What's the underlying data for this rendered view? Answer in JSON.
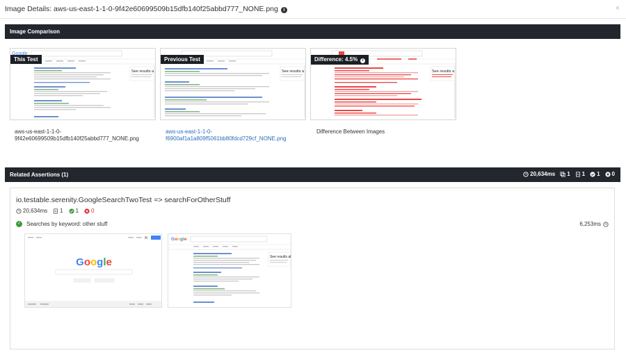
{
  "modal": {
    "title": "Image Details: aws-us-east-1-1-0-9f42e60699509b15dfb140f25abbd777_NONE.png",
    "close_label": "×"
  },
  "comparison": {
    "title": "Image Comparison",
    "this_test": {
      "label": "This Test",
      "caption": "aws-us-east-1-1-0-9f42e60699509b15dfb140f25abbd777_NONE.png"
    },
    "previous_test": {
      "label": "Previous Test",
      "caption": "aws-us-east-1-1-0-f6900af1a1a809f5061bb80fdcd729cf_NONE.png"
    },
    "difference": {
      "label": "Difference: 4.5%",
      "caption": "Difference Between Images"
    }
  },
  "assertions": {
    "title": "Related Assertions (1)",
    "stats": {
      "time": "20,634ms",
      "copies": "1",
      "docs": "1",
      "passed": "1",
      "failed": "0"
    }
  },
  "test": {
    "name": "io.testable.serenity.GoogleSearchTwoTest => searchForOtherStuff",
    "time": "20,634ms",
    "docs": "1",
    "passed": "1",
    "failed": "0",
    "assertion": {
      "label": "Searches by keyword: other stuff",
      "time": "6,253ms"
    }
  },
  "colors": {
    "header_bg": "#22262d",
    "pass": "#3c9a3c",
    "fail": "#d9302c",
    "link": "#2a6db8"
  }
}
